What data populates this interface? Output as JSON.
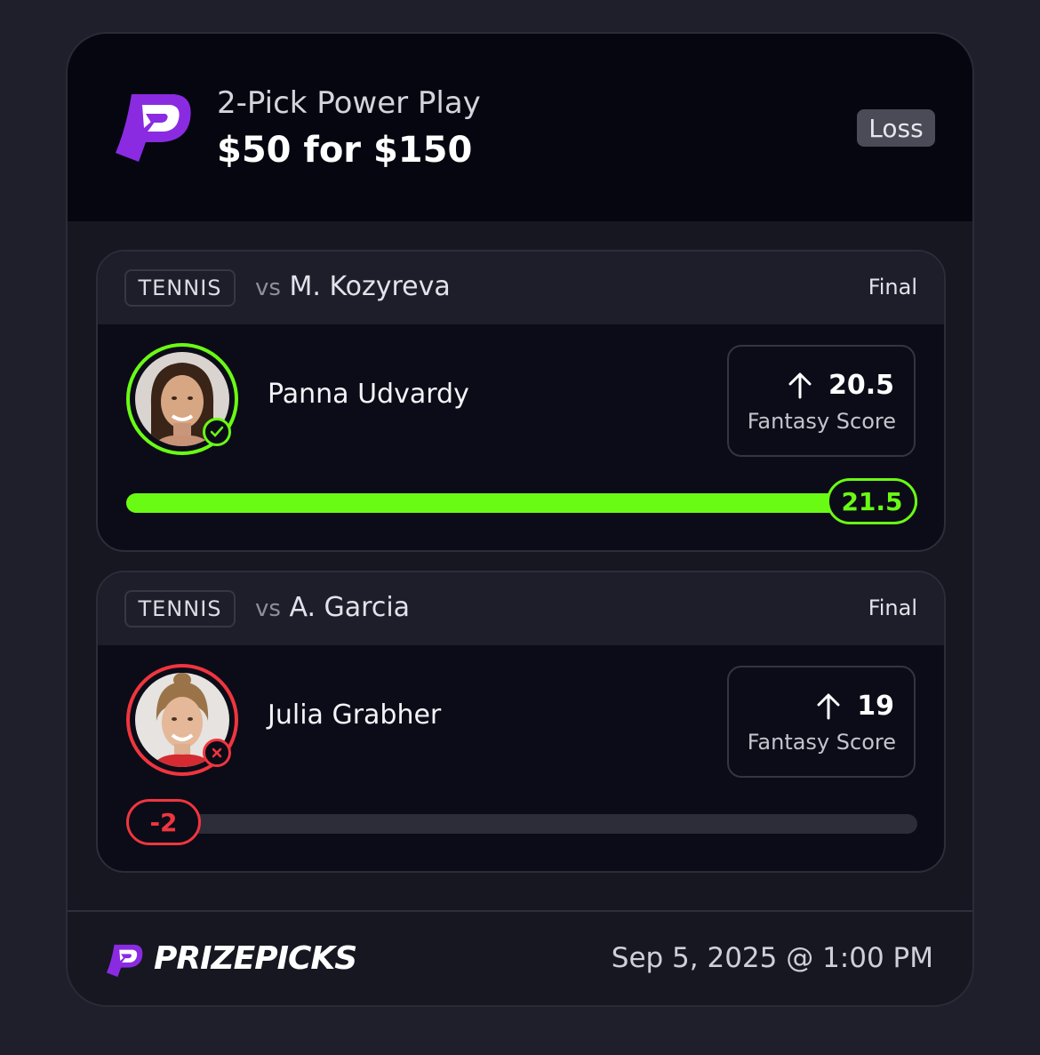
{
  "header": {
    "play_type": "2-Pick Power Play",
    "amount": "$50 for $150",
    "result": "Loss"
  },
  "picks": [
    {
      "sport": "TENNIS",
      "vs_prefix": "vs",
      "opponent": "M. Kozyreva",
      "status": "Final",
      "player": "Panna Udvardy",
      "direction_icon": "arrow-up-icon",
      "line": "20.5",
      "stat": "Fantasy Score",
      "actual": "21.5",
      "outcome": "hit",
      "outcome_color": "#6afb14",
      "progress_fraction": 1.0
    },
    {
      "sport": "TENNIS",
      "vs_prefix": "vs",
      "opponent": "A. Garcia",
      "status": "Final",
      "player": "Julia Grabher",
      "direction_icon": "arrow-up-icon",
      "line": "19",
      "stat": "Fantasy Score",
      "actual": "-2",
      "outcome": "miss",
      "outcome_color": "#f0353f",
      "progress_fraction": 0.0
    }
  ],
  "footer": {
    "brand": "PRIZEPICKS",
    "datetime": "Sep 5, 2025 @ 1:00 PM"
  },
  "colors": {
    "brand_purple": "#8a2be2",
    "win_green": "#6afb14",
    "loss_red": "#f0353f"
  }
}
